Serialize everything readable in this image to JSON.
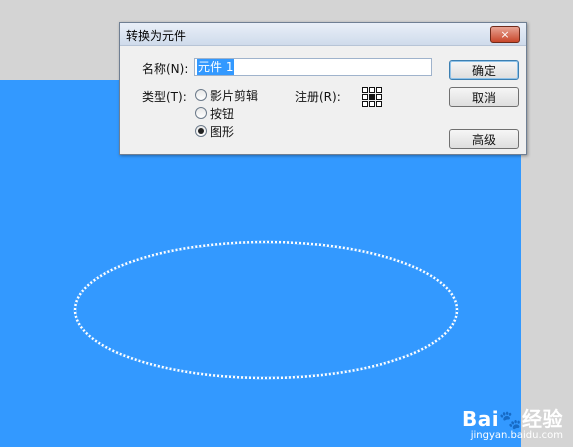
{
  "dialog": {
    "title": "转换为元件",
    "close_label": "×",
    "name_label": "名称(N):",
    "name_value": "元件 1",
    "type_label": "类型(T):",
    "type_options": [
      "影片剪辑",
      "按钮",
      "图形"
    ],
    "type_selected": "图形",
    "registration_label": "注册(R):",
    "ok_label": "确定",
    "cancel_label": "取消",
    "advanced_label": "高级"
  },
  "watermark": {
    "logo": "Bai",
    "logo_suffix": "经验",
    "url": "jingyan.baidu.com"
  },
  "colors": {
    "stage": "#3399ff",
    "workspace": "#d4d4d4"
  }
}
